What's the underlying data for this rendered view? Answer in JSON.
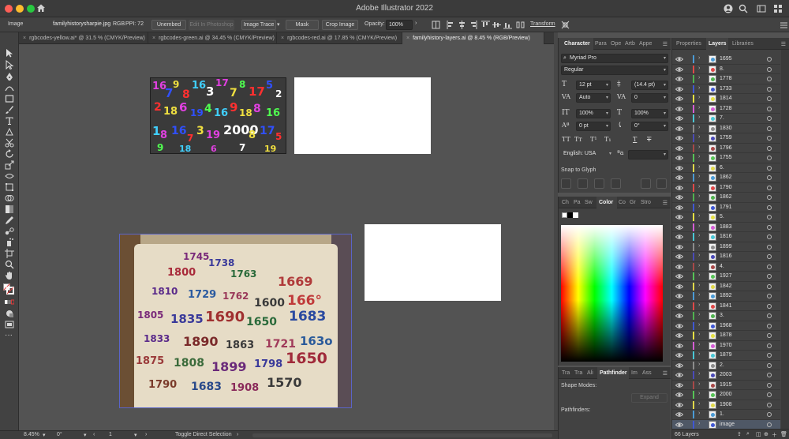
{
  "app": {
    "title": "Adobe Illustrator 2022"
  },
  "control_bar": {
    "selection_type": "Image",
    "file_name": "familyhistorysharpie.jpg",
    "color_mode": "RGB",
    "ppi_label": "PPI: 72",
    "unembed": "Unembed",
    "edit_in_photoshop": "Edit In Photoshop",
    "image_trace": "Image Trace",
    "mask": "Mask",
    "crop_image": "Crop Image",
    "opacity_label": "Opacity:",
    "opacity_value": "100%",
    "transform": "Transform"
  },
  "document_tabs": [
    {
      "label": "rgbcodes-yellow.ai* @ 31.5 % (CMYK/Preview)",
      "active": false
    },
    {
      "label": "rgbcodes-green.ai @ 34.45 % (CMYK/Preview)",
      "active": false
    },
    {
      "label": "rgbcodes-red.ai @ 17.85 % (CMYK/Preview)",
      "active": false
    },
    {
      "label": "familyhistory-layers.ai @ 8.45 % (RGB/Preview)",
      "active": true
    }
  ],
  "status_bar": {
    "zoom": "8.45%",
    "rotation": "0°",
    "artboard_number": "1",
    "tool_hint": "Toggle Direct Selection"
  },
  "character_panel": {
    "tabs": [
      "Character",
      "Para",
      "Ope",
      "Artb",
      "Appe"
    ],
    "font_family": "Myriad Pro",
    "font_style": "Regular",
    "font_size": "12 pt",
    "leading": "(14.4 pt)",
    "kerning": "Auto",
    "tracking": "0",
    "vertical_scale": "100%",
    "horizontal_scale": "100%",
    "baseline_shift": "0 pt",
    "rotation": "0°",
    "language": "English: USA",
    "snap_to_glyph": "Snap to Glyph"
  },
  "color_panel": {
    "tabs": [
      "Ch",
      "Pa",
      "Sw",
      "Color",
      "Co",
      "Gr",
      "Stro"
    ]
  },
  "pathfinder_panel": {
    "tabs": [
      "Tra",
      "Tra",
      "Ali",
      "Pathfinder",
      "Im",
      "Ass"
    ],
    "shape_modes": "Shape Modes:",
    "expand": "Expand",
    "pathfinders": "Pathfinders:"
  },
  "layers_panel": {
    "tabs": [
      "Properties",
      "Layers",
      "Libraries"
    ],
    "layers": [
      {
        "name": "1695",
        "color": "#4a9bd6"
      },
      {
        "name": "8.",
        "color": "#e04848"
      },
      {
        "name": "1778",
        "color": "#4fb34f"
      },
      {
        "name": "1733",
        "color": "#3f57d4"
      },
      {
        "name": "1814",
        "color": "#e5e044"
      },
      {
        "name": "1728",
        "color": "#d65cd6"
      },
      {
        "name": "7.",
        "color": "#49c7d6"
      },
      {
        "name": "1830",
        "color": "#8c8c8c"
      },
      {
        "name": "1759",
        "color": "#4a4ab8"
      },
      {
        "name": "1796",
        "color": "#a84848"
      },
      {
        "name": "1755",
        "color": "#56c456"
      },
      {
        "name": "6.",
        "color": "#e0d84a"
      },
      {
        "name": "1862",
        "color": "#4a9bd6"
      },
      {
        "name": "1790",
        "color": "#e04848"
      },
      {
        "name": "1862",
        "color": "#4fb34f"
      },
      {
        "name": "1791",
        "color": "#3f57d4"
      },
      {
        "name": "5.",
        "color": "#e5e044"
      },
      {
        "name": "1883",
        "color": "#d65cd6"
      },
      {
        "name": "1816",
        "color": "#49c7d6"
      },
      {
        "name": "1899",
        "color": "#8c8c8c"
      },
      {
        "name": "1816",
        "color": "#4a4ab8"
      },
      {
        "name": "4.",
        "color": "#a84848"
      },
      {
        "name": "1927",
        "color": "#56c456"
      },
      {
        "name": "1842",
        "color": "#e0d84a"
      },
      {
        "name": "1892",
        "color": "#4a9bd6"
      },
      {
        "name": "1841",
        "color": "#e04848"
      },
      {
        "name": "3.",
        "color": "#4fb34f"
      },
      {
        "name": "1968",
        "color": "#3f57d4"
      },
      {
        "name": "1878",
        "color": "#e5e044"
      },
      {
        "name": "1970",
        "color": "#d65cd6"
      },
      {
        "name": "1879",
        "color": "#49c7d6"
      },
      {
        "name": "2.",
        "color": "#8c8c8c"
      },
      {
        "name": "2003",
        "color": "#4a4ab8"
      },
      {
        "name": "1915",
        "color": "#a84848"
      },
      {
        "name": "2000",
        "color": "#56c456"
      },
      {
        "name": "1908",
        "color": "#e0d84a"
      },
      {
        "name": "1.",
        "color": "#4a9bd6"
      },
      {
        "name": "image",
        "color": "#3f57d4",
        "selected": true
      }
    ],
    "layer_count": "66 Layers"
  }
}
